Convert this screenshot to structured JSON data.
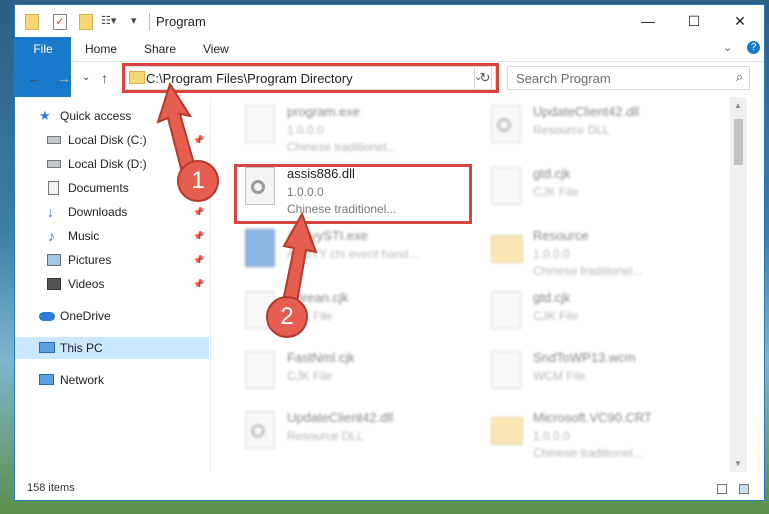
{
  "window": {
    "title": "Program",
    "controls": {
      "minimize": "—",
      "maximize": "☐",
      "close": "✕"
    }
  },
  "ribbon": {
    "tabs": [
      "File",
      "Home",
      "Share",
      "View"
    ],
    "collapse_glyph": "⌄",
    "help_glyph": "?"
  },
  "address": {
    "path": "C:\\Program Files\\Program Directory",
    "dropdown_glyph": "⌄",
    "refresh_glyph": "↻"
  },
  "search": {
    "placeholder": "Search Program",
    "icon": "search-icon"
  },
  "nav": {
    "back_glyph": "←",
    "forward_glyph": "→",
    "recent_glyph": "⌄",
    "up_glyph": "↑"
  },
  "sidebar": {
    "items": [
      {
        "label": "Quick access",
        "icon": "star-icon",
        "pinned": false
      },
      {
        "label": "Local Disk (C:)",
        "icon": "drive-icon",
        "pinned": true
      },
      {
        "label": "Local Disk (D:)",
        "icon": "drive-icon",
        "pinned": false
      },
      {
        "label": "Documents",
        "icon": "documents-icon",
        "pinned": true
      },
      {
        "label": "Downloads",
        "icon": "download-icon",
        "pinned": true
      },
      {
        "label": "Music",
        "icon": "music-icon",
        "pinned": true
      },
      {
        "label": "Pictures",
        "icon": "pictures-icon",
        "pinned": true
      },
      {
        "label": "Videos",
        "icon": "videos-icon",
        "pinned": true
      },
      {
        "label": "OneDrive",
        "icon": "cloud-icon",
        "pinned": false
      },
      {
        "label": "This PC",
        "icon": "computer-icon",
        "pinned": false,
        "selected": true
      },
      {
        "label": "Network",
        "icon": "network-icon",
        "pinned": false
      }
    ]
  },
  "files": [
    {
      "name": "program.exe",
      "line2": "1.0.0.0",
      "line3": "Chinese traditionel...",
      "icon": "exe-icon",
      "highlight": false
    },
    {
      "name": "UpdateClient42.dll",
      "line2": "Resource DLL",
      "line3": "",
      "icon": "dll-icon",
      "highlight": false
    },
    {
      "name": "assis886.dll",
      "line2": "1.0.0.0",
      "line3": "Chinese traditionel...",
      "icon": "dll-icon",
      "highlight": true
    },
    {
      "name": "gtd.cjk",
      "line2": "CJK File",
      "line3": "",
      "icon": "file-icon",
      "highlight": false
    },
    {
      "name": "AbbyySTI.exe",
      "line2": "ABBYY chi event hand...",
      "line3": "",
      "icon": "exe-icon",
      "highlight": false
    },
    {
      "name": "Resource",
      "line2": "1.0.0.0",
      "line3": "Chinese traditionel...",
      "icon": "folder-icon",
      "highlight": false
    },
    {
      "name": "Korean.cjk",
      "line2": "CJK File",
      "line3": "",
      "icon": "file-icon",
      "highlight": false
    },
    {
      "name": "gtd.cjk",
      "line2": "CJK File",
      "line3": "",
      "icon": "file-icon",
      "highlight": false
    },
    {
      "name": "FastNml.cjk",
      "line2": "CJK File",
      "line3": "",
      "icon": "file-icon",
      "highlight": false
    },
    {
      "name": "SndToWP13.wcm",
      "line2": "WCM File",
      "line3": "",
      "icon": "file-icon",
      "highlight": false
    },
    {
      "name": "UpdateClient42.dll",
      "line2": "Resource DLL",
      "line3": "",
      "icon": "dll-icon",
      "highlight": false
    },
    {
      "name": "Microsoft.VC90.CRT",
      "line2": "1.0.0.0",
      "line3": "Chinese traditionel...",
      "icon": "folder-icon",
      "highlight": false
    }
  ],
  "status": {
    "count": "158 items"
  },
  "markers": [
    {
      "label": "1"
    },
    {
      "label": "2"
    }
  ],
  "colors": {
    "accent": "#1979ca",
    "highlight_box": "#d9453d",
    "marker": "#e55e4f",
    "selection": "#cce8ff"
  }
}
